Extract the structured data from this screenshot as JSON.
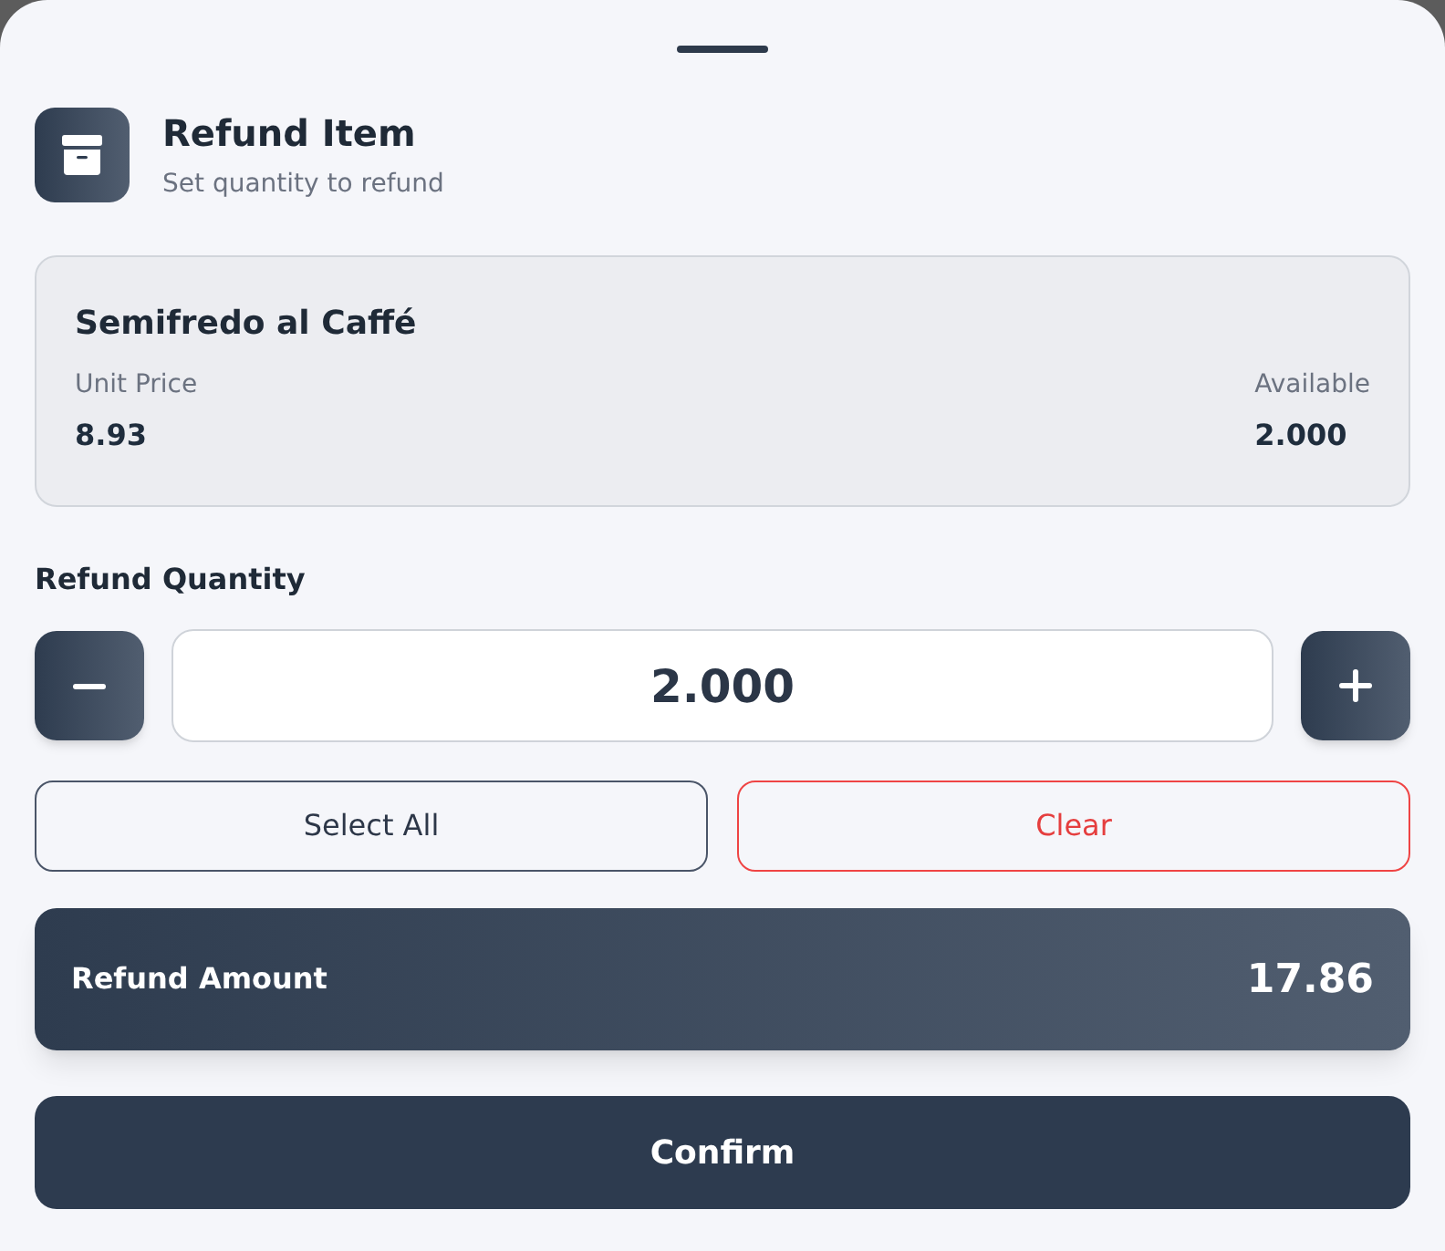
{
  "sheet": {
    "title": "Refund Item",
    "subtitle": "Set quantity to refund"
  },
  "item": {
    "name": "Semifredo al Caffé",
    "fields": [
      {
        "label": "Unit Price",
        "value": "8.93"
      },
      {
        "label": "Available",
        "value": "2.000"
      }
    ]
  },
  "quantity": {
    "label": "Refund Quantity",
    "value": "2.000"
  },
  "actions": [
    {
      "label": "Select All",
      "kind": "neutral"
    },
    {
      "label": "Clear",
      "kind": "danger"
    }
  ],
  "refund_amount": {
    "label": "Refund Amount",
    "value": "17.86"
  },
  "confirm": {
    "label": "Confirm"
  }
}
